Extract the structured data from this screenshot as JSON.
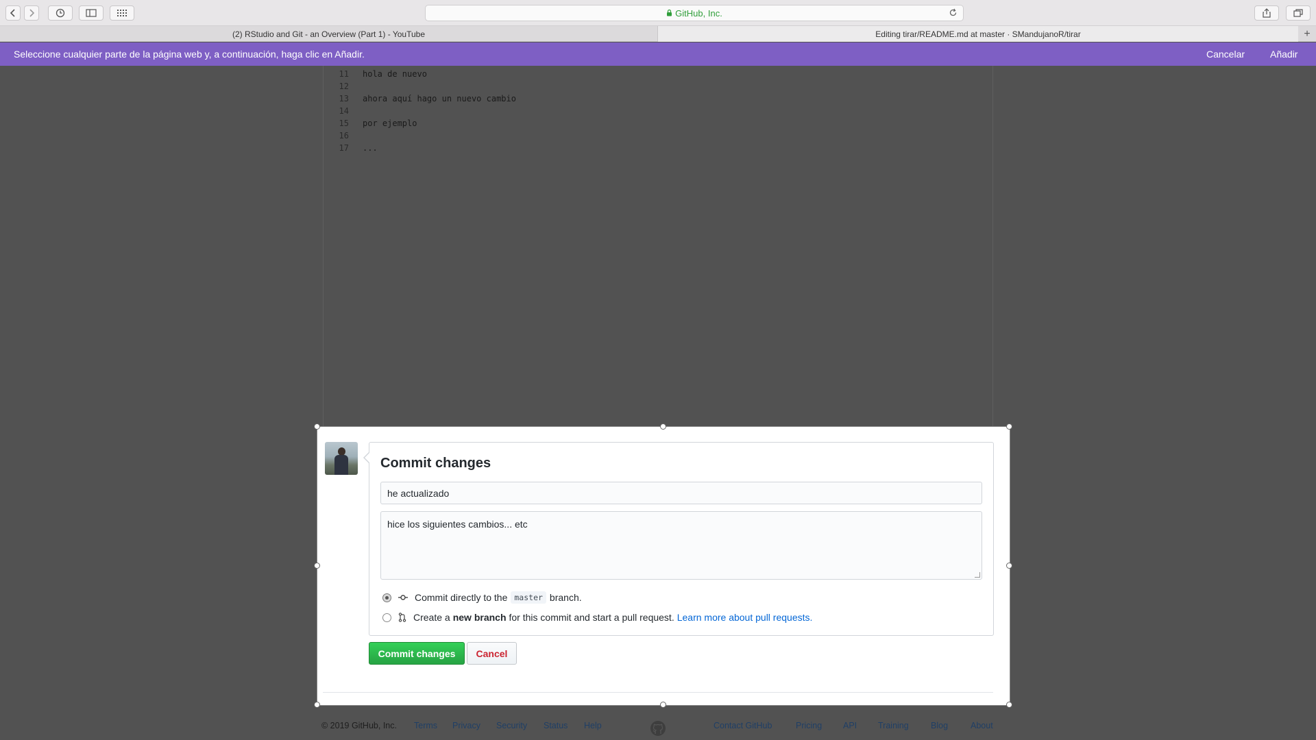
{
  "browser": {
    "address": "GitHub, Inc.",
    "tabs": [
      {
        "label": "(2) RStudio and Git - an Overview (Part 1) - YouTube"
      },
      {
        "label": "Editing tirar/README.md at master · SMandujanoR/tirar"
      }
    ]
  },
  "prompt_bar": {
    "message": "Seleccione cualquier parte de la página web y, a continuación, haga clic en Añadir.",
    "cancel_label": "Cancelar",
    "add_label": "Añadir"
  },
  "editor": {
    "lines": [
      {
        "n": "11",
        "text": "hola de nuevo"
      },
      {
        "n": "12",
        "text": ""
      },
      {
        "n": "13",
        "text": "ahora aquí hago un nuevo cambio"
      },
      {
        "n": "14",
        "text": ""
      },
      {
        "n": "15",
        "text": "por ejemplo"
      },
      {
        "n": "16",
        "text": ""
      },
      {
        "n": "17",
        "text": "..."
      }
    ]
  },
  "commit": {
    "title": "Commit changes",
    "summary_value": "he actualizado",
    "description_value": "hice los siguientes cambios... etc",
    "option_direct_prefix": "Commit directly to the",
    "branch_name": "master",
    "option_direct_suffix": "branch.",
    "option_new_prefix": "Create a",
    "option_new_bold": "new branch",
    "option_new_suffix": "for this commit and start a pull request.",
    "option_new_link": "Learn more about pull requests.",
    "selected_option": "direct",
    "commit_button": "Commit changes",
    "cancel_button": "Cancel"
  },
  "footer": {
    "copyright": "© 2019 GitHub, Inc.",
    "left_links": [
      "Terms",
      "Privacy",
      "Security",
      "Status",
      "Help"
    ],
    "right_links": [
      "Contact GitHub",
      "Pricing",
      "API",
      "Training",
      "Blog",
      "About"
    ]
  },
  "colors": {
    "prompt_bar": "#7e5fc4",
    "commit_green": "#28a745",
    "cancel_red": "#cb2431",
    "link_blue": "#0366d6"
  }
}
